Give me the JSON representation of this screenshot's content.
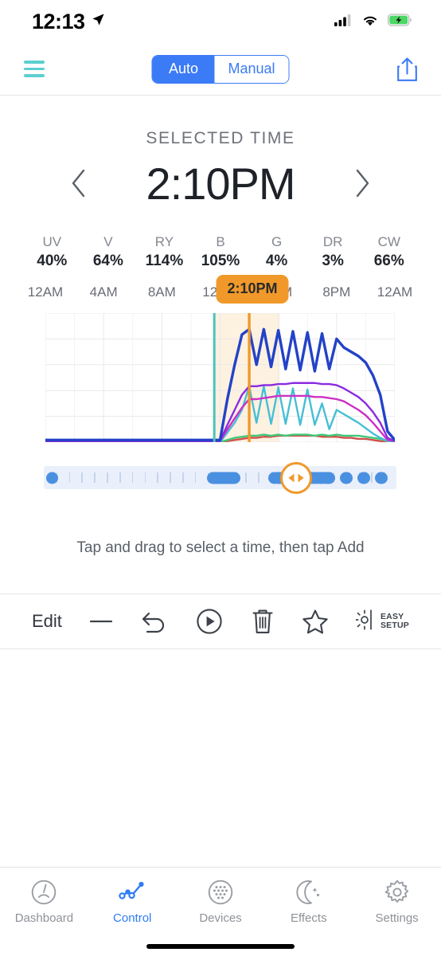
{
  "status_bar": {
    "time": "12:13",
    "location_icon": "location-arrow-icon",
    "signal_icon": "cellular-signal-icon",
    "wifi_icon": "wifi-icon",
    "battery_icon": "battery-charging-icon",
    "battery_color": "#4cd764"
  },
  "nav": {
    "menu_icon": "hamburger-menu-icon",
    "menu_color": "#5ccfd1",
    "share_icon": "share-upload-icon",
    "share_color": "#3b7bf5",
    "mode_auto": "Auto",
    "mode_manual": "Manual",
    "active_mode": "Auto",
    "accent": "#3b7bf5"
  },
  "selected_time": {
    "label": "SELECTED TIME",
    "value": "2:10PM",
    "prev_icon": "chevron-left-icon",
    "next_icon": "chevron-right-icon"
  },
  "channels": [
    {
      "name": "UV",
      "value": "40%"
    },
    {
      "name": "V",
      "value": "64%"
    },
    {
      "name": "RY",
      "value": "114%"
    },
    {
      "name": "B",
      "value": "105%"
    },
    {
      "name": "G",
      "value": "4%"
    },
    {
      "name": "DR",
      "value": "3%"
    },
    {
      "name": "CW",
      "value": "66%"
    }
  ],
  "chart_data": {
    "type": "line",
    "title": "",
    "xlabel": "",
    "ylabel": "",
    "grid": true,
    "legend": false,
    "marker_time": "2:10PM",
    "marker_color": "#f0992a",
    "band_color": "#fdf1e0",
    "band_edge_color": "#4cc3ba",
    "x_tick_labels": [
      "12AM",
      "4AM",
      "8AM",
      "12PM",
      "4PM",
      "8PM",
      "12AM"
    ],
    "x_tick_hours": [
      0,
      4,
      8,
      12,
      16,
      20,
      24
    ],
    "xlim": [
      0,
      24
    ],
    "ylim": [
      0,
      120
    ],
    "x": [
      0,
      1,
      2,
      3,
      4,
      5,
      6,
      7,
      8,
      9,
      10,
      11,
      12,
      12.5,
      13,
      13.5,
      14,
      14.5,
      15,
      15.5,
      16,
      16.5,
      17,
      17.5,
      18,
      18.5,
      19,
      19.5,
      20,
      20.5,
      21,
      21.5,
      22,
      22.5,
      23,
      23.5,
      24
    ],
    "series": [
      {
        "name": "B",
        "color": "#2342c8",
        "values": [
          2,
          2,
          2,
          2,
          2,
          2,
          2,
          2,
          2,
          2,
          2,
          2,
          2,
          40,
          72,
          100,
          105,
          72,
          105,
          70,
          104,
          68,
          103,
          67,
          102,
          66,
          101,
          68,
          96,
          88,
          84,
          80,
          74,
          62,
          44,
          10,
          2
        ]
      },
      {
        "name": "CW",
        "color": "#8a2be2",
        "values": [
          1,
          1,
          1,
          1,
          1,
          1,
          1,
          1,
          1,
          1,
          1,
          1,
          1,
          16,
          30,
          44,
          52,
          52,
          53,
          53,
          54,
          54,
          55,
          55,
          55,
          55,
          54,
          54,
          53,
          50,
          46,
          42,
          36,
          28,
          18,
          4,
          1
        ]
      },
      {
        "name": "V",
        "color": "#cc31c4",
        "values": [
          1,
          1,
          1,
          1,
          1,
          1,
          1,
          1,
          1,
          1,
          1,
          1,
          1,
          12,
          22,
          32,
          40,
          40,
          41,
          42,
          43,
          43,
          43,
          43,
          43,
          42,
          42,
          41,
          40,
          38,
          34,
          30,
          25,
          18,
          10,
          2,
          1
        ]
      },
      {
        "name": "RY",
        "color": "#45bfd6",
        "values": [
          0,
          0,
          0,
          0,
          0,
          0,
          0,
          0,
          0,
          0,
          0,
          0,
          0,
          9,
          18,
          30,
          52,
          18,
          52,
          17,
          51,
          17,
          50,
          16,
          49,
          16,
          36,
          12,
          30,
          26,
          22,
          18,
          13,
          8,
          4,
          1,
          0
        ]
      },
      {
        "name": "G",
        "color": "#3fc878",
        "values": [
          0,
          0,
          0,
          0,
          0,
          0,
          0,
          0,
          0,
          0,
          0,
          0,
          0,
          2,
          4,
          5,
          6,
          6,
          7,
          6,
          7,
          6,
          7,
          7,
          7,
          6,
          7,
          6,
          7,
          6,
          6,
          6,
          5,
          4,
          3,
          1,
          0
        ]
      },
      {
        "name": "DR",
        "color": "#d0504a",
        "values": [
          0,
          0,
          0,
          0,
          0,
          0,
          0,
          0,
          0,
          0,
          0,
          0,
          0,
          1,
          2,
          3,
          4,
          4,
          5,
          5,
          6,
          6,
          6,
          6,
          6,
          6,
          5,
          5,
          5,
          4,
          4,
          3,
          3,
          2,
          1,
          0,
          0
        ]
      }
    ]
  },
  "scrubber": {
    "handle_icon": "drag-left-right-handle",
    "handle_color": "#f0992a",
    "keyframe_color": "#4a90e0"
  },
  "hint": "Tap and drag to select a time, then tap Add",
  "toolbar": {
    "edit_label": "Edit",
    "minus_icon": "minus-icon",
    "undo_icon": "undo-arrow-icon",
    "play_icon": "play-circle-icon",
    "trash_icon": "trash-can-icon",
    "star_icon": "star-outline-icon",
    "easy_setup_icon": "light-bulb-icon",
    "easy_setup_line1": "EASY",
    "easy_setup_line2": "SETUP"
  },
  "tabs": [
    {
      "label": "Dashboard",
      "icon": "gauge-icon",
      "active": false
    },
    {
      "label": "Control",
      "icon": "line-chart-icon",
      "active": true
    },
    {
      "label": "Devices",
      "icon": "dots-circle-icon",
      "active": false
    },
    {
      "label": "Effects",
      "icon": "moon-stars-icon",
      "active": false
    },
    {
      "label": "Settings",
      "icon": "gear-icon",
      "active": false
    }
  ]
}
